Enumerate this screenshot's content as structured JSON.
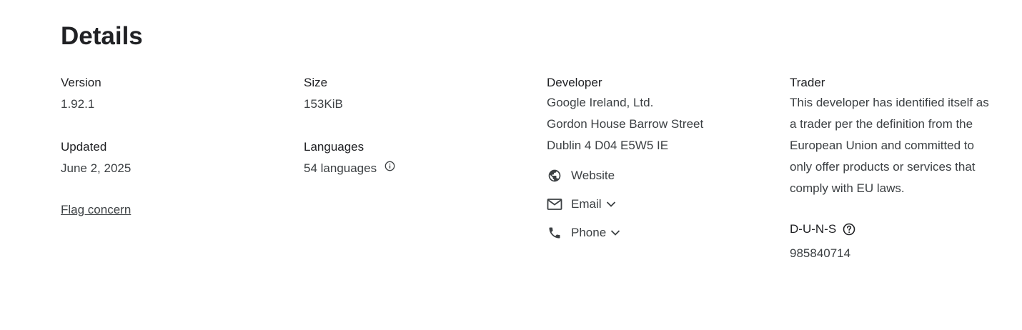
{
  "title": "Details",
  "version": {
    "label": "Version",
    "value": "1.92.1"
  },
  "updated": {
    "label": "Updated",
    "value": "June 2, 2025"
  },
  "flag_concern": "Flag concern",
  "size": {
    "label": "Size",
    "value": "153KiB"
  },
  "languages": {
    "label": "Languages",
    "value": "54 languages"
  },
  "developer": {
    "label": "Developer",
    "name": "Google Ireland, Ltd.",
    "address1": "Gordon House Barrow Street",
    "address2": "Dublin 4 D04 E5W5 IE",
    "website": "Website",
    "email": "Email",
    "phone": "Phone"
  },
  "trader": {
    "label": "Trader",
    "text": "This developer has identified itself as a trader per the definition from the European Union and committed to only offer products or services that comply with EU laws."
  },
  "duns": {
    "label": "D-U-N-S",
    "value": "985840714"
  },
  "icons": {
    "info": "info-icon",
    "globe": "globe-icon",
    "mail": "mail-icon",
    "phone": "phone-icon",
    "chevron": "chevron-down-icon",
    "help": "help-circle-icon"
  }
}
